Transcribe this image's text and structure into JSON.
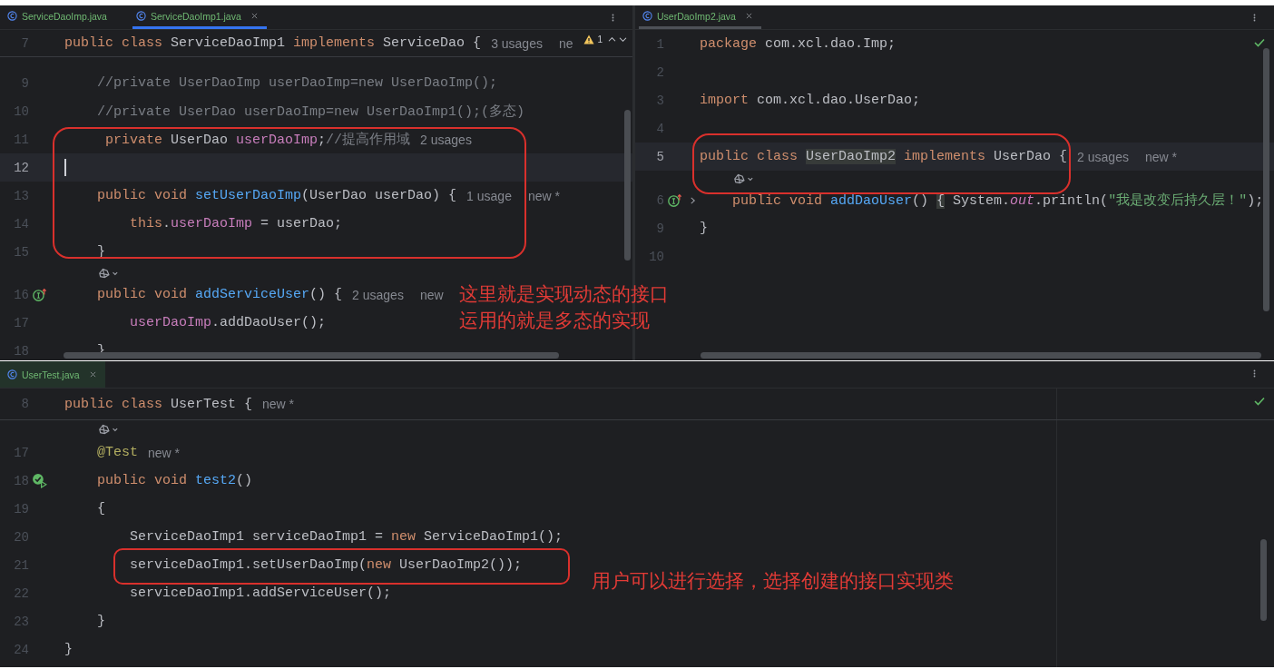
{
  "editors": [
    {
      "focused": true,
      "inspection": {
        "kind": "warning",
        "count": "1"
      },
      "tabs": [
        {
          "label": "ServiceDaoImp.java",
          "selected": false,
          "closable": false
        },
        {
          "label": "ServiceDaoImp1.java",
          "selected": true,
          "closable": true
        }
      ],
      "lines": [
        {
          "kind": "header",
          "number": "7",
          "current": false,
          "code": [
            {
              "kind": "kw",
              "t": "public class "
            },
            {
              "kind": "plain",
              "t": "ServiceDaoImp1 "
            },
            {
              "kind": "kw",
              "t": "implements "
            },
            {
              "kind": "plain",
              "t": "ServiceDao {"
            }
          ],
          "hints": [
            "3 usages",
            "ne"
          ],
          "children": [
            {
              "kind": "code",
              "number": "9",
              "current": false,
              "code": [
                {
                  "kind": "comment",
                  "t": "//private UserDaoImp userDaoImp=new UserDaoImp();"
                }
              ]
            },
            {
              "kind": "code",
              "number": "10",
              "current": false,
              "code": [
                {
                  "kind": "comment",
                  "t": "//private UserDao userDaoImp=new UserDaoImp1();(多态)"
                }
              ]
            },
            {
              "kind": "code",
              "number": "11",
              "current": false,
              "code": [
                {
                  "kind": "kw",
                  "t": " private "
                },
                {
                  "kind": "plain",
                  "t": "UserDao "
                },
                {
                  "kind": "field",
                  "t": "userDaoImp"
                },
                {
                  "kind": "plain",
                  "t": ";"
                },
                {
                  "kind": "comment",
                  "t": "//提高作用域"
                }
              ],
              "hints": [
                "2 usages"
              ]
            },
            {
              "kind": "code",
              "number": "12",
              "current": true
            },
            {
              "kind": "code",
              "number": "13",
              "current": false,
              "code": [
                {
                  "kind": "kw",
                  "t": "public void "
                },
                {
                  "kind": "fn",
                  "t": "setUserDaoImp"
                },
                {
                  "kind": "plain",
                  "t": "(UserDao userDao) {"
                }
              ],
              "hints": [
                "1 usage",
                "new *"
              ],
              "children": [
                {
                  "kind": "code",
                  "number": "14",
                  "current": false,
                  "code": [
                    {
                      "kind": "kw",
                      "t": "this"
                    },
                    {
                      "kind": "plain",
                      "t": "."
                    },
                    {
                      "kind": "field",
                      "t": "userDaoImp"
                    },
                    {
                      "kind": "plain",
                      "t": " = userDao;"
                    }
                  ]
                }
              ]
            },
            {
              "kind": "code",
              "number": "15",
              "current": false,
              "code": [
                {
                  "kind": "plain",
                  "t": "}"
                }
              ]
            },
            {
              "kind": "icon"
            },
            {
              "kind": "code",
              "number": "16",
              "current": false,
              "gutter": [
                {
                  "kind": "implements"
                }
              ],
              "code": [
                {
                  "kind": "kw",
                  "t": "public void "
                },
                {
                  "kind": "fn",
                  "t": "addServiceUser"
                },
                {
                  "kind": "plain",
                  "t": "() {"
                }
              ],
              "hints": [
                "2 usages",
                "new"
              ],
              "children": [
                {
                  "kind": "code",
                  "number": "17",
                  "current": false,
                  "code": [
                    {
                      "kind": "field",
                      "t": "userDaoImp"
                    },
                    {
                      "kind": "plain",
                      "t": ".addDaoUser();"
                    }
                  ]
                }
              ]
            },
            {
              "kind": "code",
              "number": "18",
              "current": false,
              "code": [
                {
                  "kind": "plain",
                  "t": "}"
                }
              ]
            }
          ]
        }
      ]
    },
    {
      "focused": false,
      "inspection": {
        "kind": "ok"
      },
      "tabs": [
        {
          "label": "UserDaoImp2.java",
          "selected": true,
          "closable": true
        }
      ],
      "lines": [
        {
          "kind": "code",
          "number": "1",
          "current": false,
          "code": [
            {
              "kind": "kw",
              "t": "package "
            },
            {
              "kind": "plain",
              "t": "com.xcl.dao.Imp;"
            }
          ]
        },
        {
          "kind": "code",
          "number": "2",
          "current": false
        },
        {
          "kind": "code",
          "number": "3",
          "current": false,
          "code": [
            {
              "kind": "kw",
              "t": "import "
            },
            {
              "kind": "plain",
              "t": "com.xcl.dao.UserDao;"
            }
          ]
        },
        {
          "kind": "code",
          "number": "4",
          "current": false
        },
        {
          "kind": "code",
          "number": "5",
          "current": true,
          "code": [
            {
              "kind": "kw",
              "t": "public class "
            },
            {
              "kind": "sel",
              "t": "UserDaoImp2"
            },
            {
              "kind": "kw",
              "t": " implements "
            },
            {
              "kind": "plain",
              "t": "UserDao {"
            }
          ],
          "hints": [
            "2 usages",
            "new *"
          ],
          "children": [
            {
              "kind": "icon"
            },
            {
              "kind": "code",
              "number": "6",
              "current": false,
              "gutter": [
                {
                  "kind": "implements"
                },
                {
                  "kind": "fold"
                }
              ],
              "code": [
                {
                  "kind": "kw",
                  "t": "public void "
                },
                {
                  "kind": "fn",
                  "t": "addDaoUser"
                },
                {
                  "kind": "plain",
                  "t": "() "
                },
                {
                  "kind": "sel",
                  "t": "{"
                },
                {
                  "kind": "plain",
                  "t": " System."
                },
                {
                  "kind": "static",
                  "t": "out"
                },
                {
                  "kind": "plain",
                  "t": ".println("
                },
                {
                  "kind": "str",
                  "t": "\"我是改变后持久层！\""
                },
                {
                  "kind": "plain",
                  "t": ");"
                }
              ]
            }
          ]
        },
        {
          "kind": "code",
          "number": "9",
          "current": false,
          "code": [
            {
              "kind": "plain",
              "t": "}"
            }
          ]
        },
        {
          "kind": "code",
          "number": "10",
          "current": false
        }
      ]
    },
    {
      "focused": false,
      "inspection": {
        "kind": "ok"
      },
      "tabs": [
        {
          "label": "UserTest.java",
          "selected": true,
          "closable": true
        }
      ],
      "lines": [
        {
          "kind": "header",
          "number": "8",
          "current": false,
          "code": [
            {
              "kind": "kw",
              "t": "public class "
            },
            {
              "kind": "plain",
              "t": "UserTest {"
            }
          ],
          "hints": [
            "new *"
          ],
          "children": [
            {
              "kind": "icon"
            },
            {
              "kind": "code",
              "number": "17",
              "current": false,
              "code": [
                {
                  "kind": "annot",
                  "t": "@Test"
                }
              ],
              "hints": [
                "new *"
              ]
            },
            {
              "kind": "code",
              "number": "18",
              "current": false,
              "gutter": [
                {
                  "kind": "run"
                }
              ],
              "code": [
                {
                  "kind": "kw",
                  "t": "public void "
                },
                {
                  "kind": "fn",
                  "t": "test2"
                },
                {
                  "kind": "plain",
                  "t": "()"
                }
              ]
            },
            {
              "kind": "code",
              "number": "19",
              "current": false,
              "code": [
                {
                  "kind": "plain",
                  "t": "{"
                }
              ],
              "children": [
                {
                  "kind": "code",
                  "number": "20",
                  "current": false,
                  "code": [
                    {
                      "kind": "plain",
                      "t": "ServiceDaoImp1 serviceDaoImp1 = "
                    },
                    {
                      "kind": "kw",
                      "t": "new "
                    },
                    {
                      "kind": "plain",
                      "t": "ServiceDaoImp1();"
                    }
                  ]
                },
                {
                  "kind": "code",
                  "number": "21",
                  "current": false,
                  "code": [
                    {
                      "kind": "plain",
                      "t": "serviceDaoImp1.setUserDaoImp("
                    },
                    {
                      "kind": "kw",
                      "t": "new "
                    },
                    {
                      "kind": "plain",
                      "t": "UserDaoImp2());"
                    }
                  ]
                },
                {
                  "kind": "code",
                  "number": "22",
                  "current": false,
                  "code": [
                    {
                      "kind": "plain",
                      "t": "serviceDaoImp1.addServiceUser();"
                    }
                  ]
                }
              ]
            },
            {
              "kind": "code",
              "number": "23",
              "current": false,
              "code": [
                {
                  "kind": "plain",
                  "t": "}"
                }
              ]
            }
          ]
        },
        {
          "kind": "code",
          "number": "24",
          "current": false,
          "code": [
            {
              "kind": "plain",
              "t": "}"
            }
          ]
        }
      ]
    }
  ],
  "notes": [
    {
      "lines": [
        "这里就是实现动态的接口",
        "运用的就是多态的实现"
      ]
    },
    {
      "lines": [
        "用户可以进行选择，选择创建的接口实现类"
      ]
    }
  ]
}
